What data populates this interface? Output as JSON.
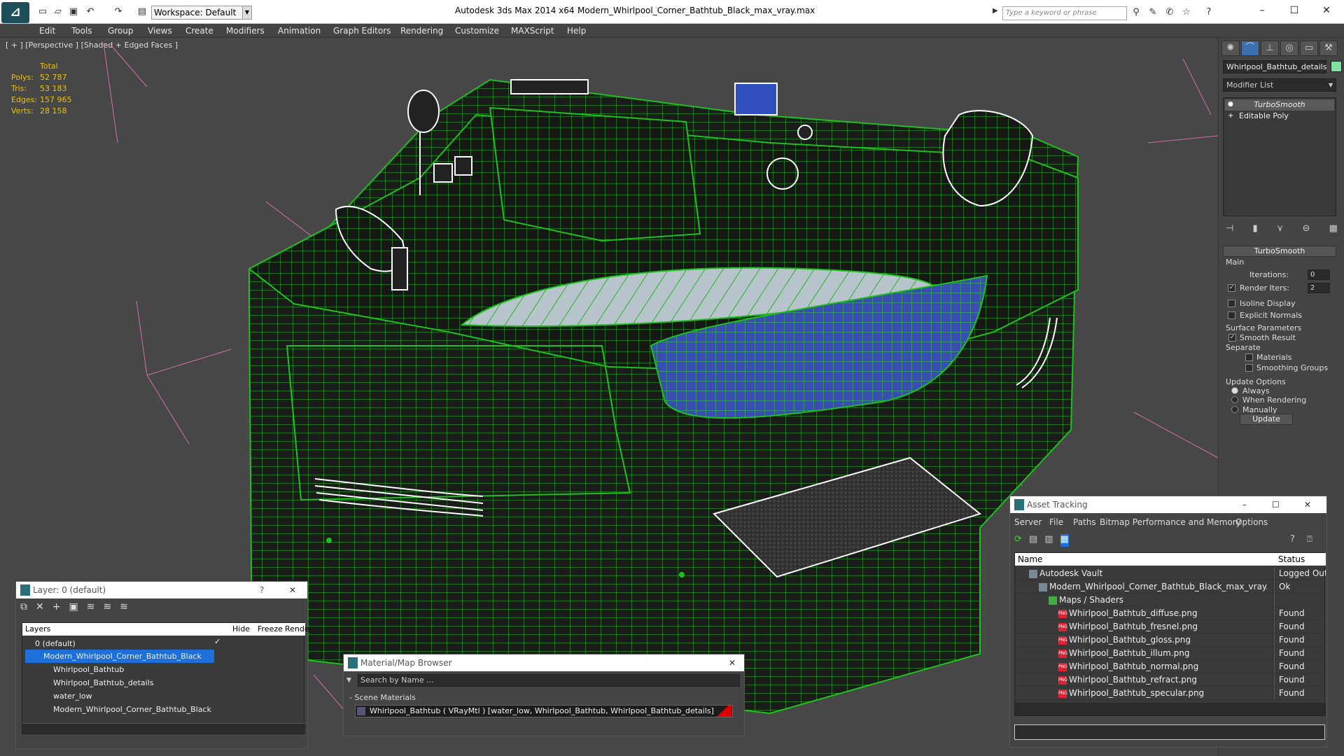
{
  "titlebar": {
    "app_title": "Autodesk 3ds Max  2014 x64",
    "file_title": "Modern_Whirlpool_Corner_Bathtub_Black_max_vray.max",
    "workspace": "Workspace: Default",
    "search_placeholder": "Type a keyword or phrase"
  },
  "menu": [
    "Edit",
    "Tools",
    "Group",
    "Views",
    "Create",
    "Modifiers",
    "Animation",
    "Graph Editors",
    "Rendering",
    "Customize",
    "MAXScript",
    "Help"
  ],
  "viewport": {
    "label": "[ + ] [Perspective ] [Shaded + Edged Faces ]",
    "stats": {
      "header": "Total",
      "rows": [
        {
          "label": "Polys:",
          "value": "52 787"
        },
        {
          "label": "Tris:",
          "value": "53 183"
        },
        {
          "label": "Edges:",
          "value": "157 965"
        },
        {
          "label": "Verts:",
          "value": "28 158"
        }
      ]
    }
  },
  "command_panel": {
    "object_name": "Whirlpool_Bathtub_details",
    "modifier_list": "Modifier List",
    "stack": [
      "TurboSmooth",
      "Editable Poly"
    ],
    "rollout_title": "TurboSmooth",
    "main_label": "Main",
    "iterations_label": "Iterations:",
    "iterations_value": "0",
    "render_iters_label": "Render Iters:",
    "render_iters_value": "2",
    "isoline_display": "Isoline Display",
    "explicit_normals": "Explicit Normals",
    "surface_params": "Surface Parameters",
    "smooth_result": "Smooth Result",
    "separate": "Separate",
    "materials": "Materials",
    "smoothing_groups": "Smoothing Groups",
    "update_options": "Update Options",
    "always": "Always",
    "when_rendering": "When Rendering",
    "manually": "Manually",
    "update_button": "Update"
  },
  "layer_panel": {
    "title": "Layer: 0 (default)",
    "help": "?",
    "columns": [
      "Layers",
      "Hide",
      "Freeze",
      "Rende"
    ],
    "rows": [
      "0 (default)",
      "Modern_Whirlpool_Corner_Bathtub_Black",
      "Whirlpool_Bathtub",
      "Whirlpool_Bathtub_details",
      "water_low",
      "Modern_Whirlpool_Corner_Bathtub_Black"
    ]
  },
  "material_browser": {
    "title": "Material/Map Browser",
    "search_placeholder": "Search by Name ...",
    "section": "- Scene Materials",
    "material": "Whirlpool_Bathtub  ( VRayMtl ) [water_low, Whirlpool_Bathtub, Whirlpool_Bathtub_details]"
  },
  "asset_tracking": {
    "title": "Asset Tracking",
    "menu": [
      "Server",
      "File",
      "Paths",
      "Bitmap Performance and Memory",
      "Options"
    ],
    "col_name": "Name",
    "col_status": "Status",
    "rows": [
      {
        "name": "Autodesk Vault",
        "status": "Logged Out",
        "indent": 0,
        "icon": "vault-icon"
      },
      {
        "name": "Modern_Whirlpool_Corner_Bathtub_Black_max_vray.max",
        "status": "Ok",
        "indent": 1,
        "icon": "max-file-icon"
      },
      {
        "name": "Maps / Shaders",
        "status": "",
        "indent": 2,
        "icon": "maps-icon"
      },
      {
        "name": "Whirlpool_Bathtub_diffuse.png",
        "status": "Found",
        "indent": 3,
        "icon": "png-icon"
      },
      {
        "name": "Whirlpool_Bathtub_fresnel.png",
        "status": "Found",
        "indent": 3,
        "icon": "png-icon"
      },
      {
        "name": "Whirlpool_Bathtub_gloss.png",
        "status": "Found",
        "indent": 3,
        "icon": "png-icon"
      },
      {
        "name": "Whirlpool_Bathtub_illum.png",
        "status": "Found",
        "indent": 3,
        "icon": "png-icon"
      },
      {
        "name": "Whirlpool_Bathtub_normal.png",
        "status": "Found",
        "indent": 3,
        "icon": "png-icon"
      },
      {
        "name": "Whirlpool_Bathtub_refract.png",
        "status": "Found",
        "indent": 3,
        "icon": "png-icon"
      },
      {
        "name": "Whirlpool_Bathtub_specular.png",
        "status": "Found",
        "indent": 3,
        "icon": "png-icon"
      }
    ]
  },
  "colors": {
    "wire": "#1fbf1f",
    "accent": "#1e6fd9",
    "stats": "#e8c000"
  }
}
